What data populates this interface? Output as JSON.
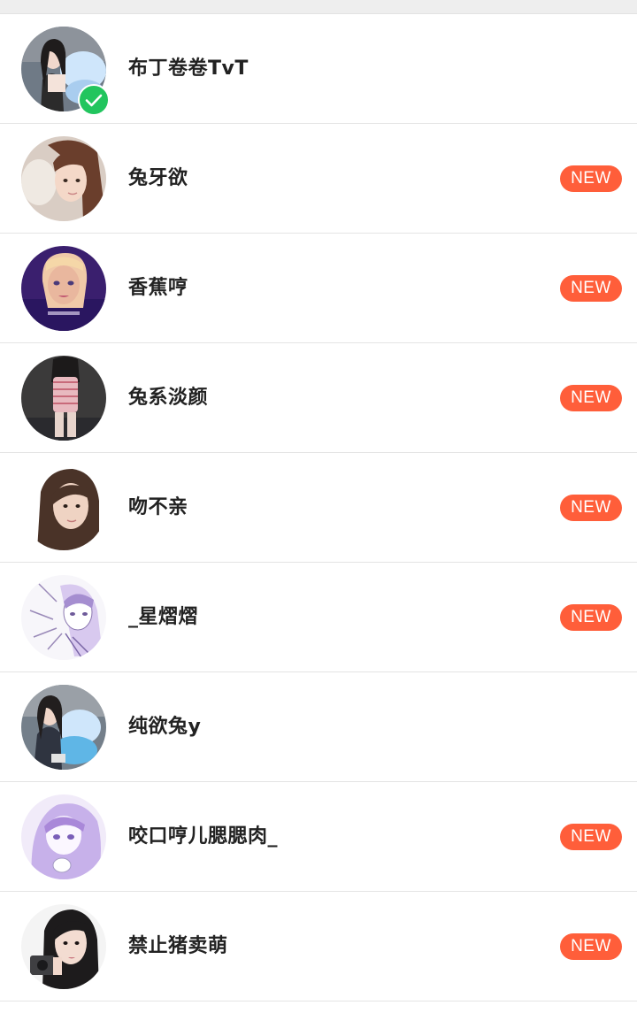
{
  "colors": {
    "badge": "#ff5e3a",
    "check": "#22c55e",
    "divider": "#e4e4e4"
  },
  "contacts": [
    {
      "name": "布丁卷卷TvT",
      "badge": "",
      "verified": true,
      "avatar_icon": "girl-with-plush-avatar"
    },
    {
      "name": "兔牙欲",
      "badge": "NEW",
      "verified": false,
      "avatar_icon": "girl-selfie-avatar"
    },
    {
      "name": "香蕉哼",
      "badge": "NEW",
      "verified": false,
      "avatar_icon": "animated-doll-avatar"
    },
    {
      "name": "兔系淡颜",
      "badge": "NEW",
      "verified": false,
      "avatar_icon": "mirror-selfie-avatar"
    },
    {
      "name": "吻不亲",
      "badge": "NEW",
      "verified": false,
      "avatar_icon": "girl-portrait-avatar"
    },
    {
      "name": "_星熠熠",
      "badge": "NEW",
      "verified": false,
      "avatar_icon": "anime-sketch-avatar"
    },
    {
      "name": "纯欲兔y",
      "badge": "",
      "verified": false,
      "avatar_icon": "girl-with-plush-avatar"
    },
    {
      "name": "咬口哼儿腮腮肉_",
      "badge": "NEW",
      "verified": false,
      "avatar_icon": "anime-purple-avatar"
    },
    {
      "name": "禁止猪卖萌",
      "badge": "NEW",
      "verified": false,
      "avatar_icon": "girl-camera-avatar"
    }
  ]
}
